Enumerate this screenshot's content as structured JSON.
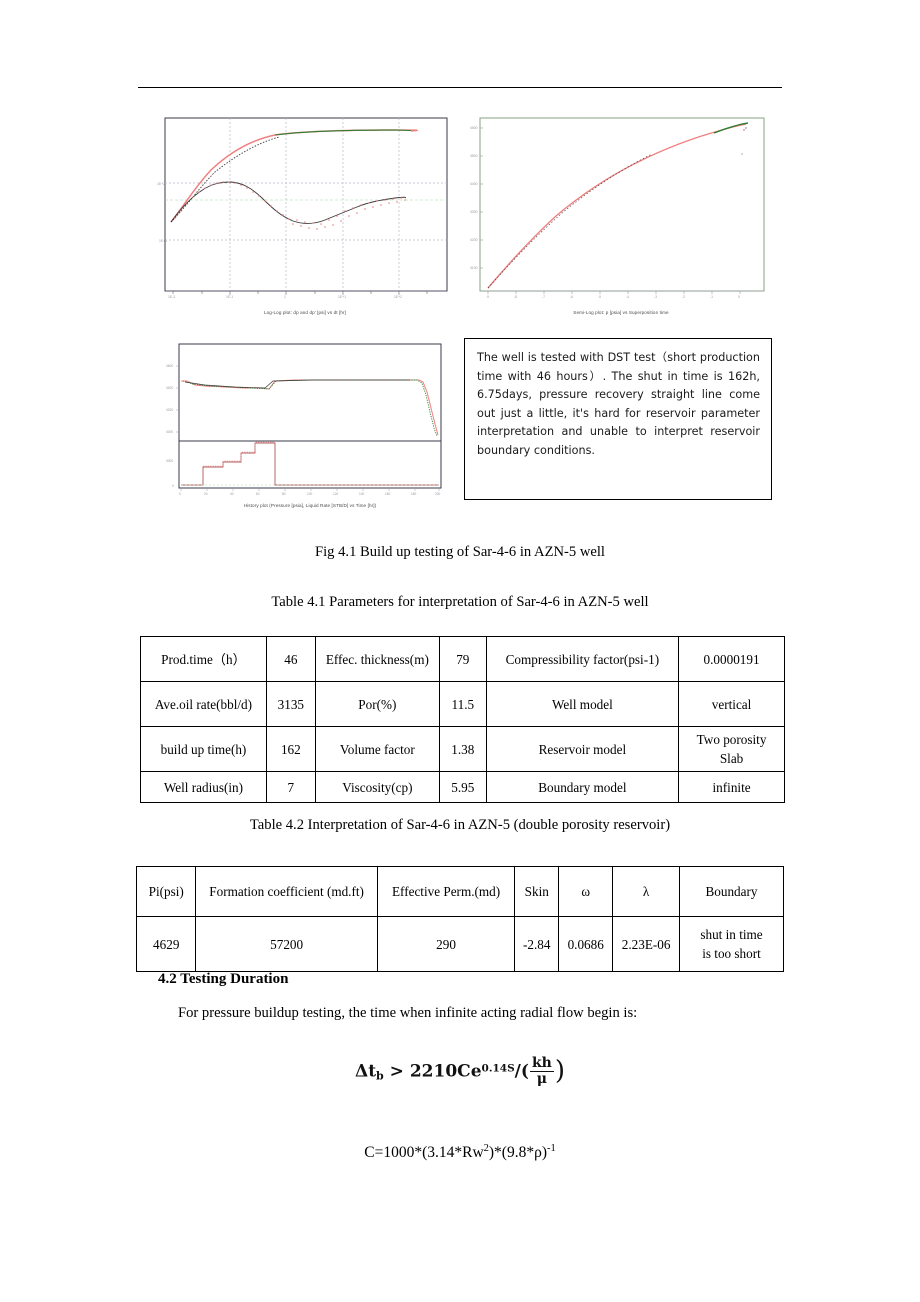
{
  "document": {
    "figure": {
      "title": "Fig 4.1 Build up testing of Sar-4-6 in AZN-5 well",
      "charts": [
        {
          "id": "loglog",
          "caption": "Log-Log plot: dp and dp' [psi] vs dt [hr]",
          "x_ticks": [
            "1E-3",
            "1E-1",
            "1",
            "1E+1",
            "1E+2"
          ],
          "y_ticks": [
            "1E+2",
            "1E+1"
          ]
        },
        {
          "id": "semilog",
          "caption": "Semi-Log plot: p [psia] vs Superposition time",
          "x_ticks": [
            "-9",
            "-8",
            "-7",
            "-6",
            "-5",
            "-4",
            "-3",
            "-2",
            "-1",
            "0"
          ],
          "y_ticks": [
            "4600",
            "4500",
            "4400",
            "4300",
            "4200",
            "4100"
          ]
        },
        {
          "id": "history",
          "caption": "History plot (Pressure [psia], Liquid Rate [STB/D] vs Time [hr])",
          "x_ticks": [
            "0",
            "20",
            "40",
            "60",
            "80",
            "100",
            "120",
            "140",
            "160",
            "180",
            "200"
          ],
          "y_ticks_top": [
            "4600",
            "4400",
            "4200",
            "4000"
          ],
          "y_ticks_bottom": [
            "3000",
            "0"
          ]
        }
      ]
    },
    "notebox": {
      "text": "The well is tested with DST test（short production time with 46 hours）. The shut in time is 162h, 6.75days, pressure recovery straight line come out just a little, it's hard for reservoir parameter interpretation and unable to interpret reservoir boundary conditions."
    },
    "table41": {
      "title": "Table 4.1 Parameters for interpretation of Sar-4-6 in AZN-5 well",
      "rows": [
        [
          "Prod.time（h）",
          "46",
          "Effec. thickness(m)",
          "79",
          "Compressibility factor(psi-1)",
          "0.0000191"
        ],
        [
          "Ave.oil rate(bbl/d)",
          "3135",
          "Por(%)",
          "11.5",
          "Well model",
          "vertical"
        ],
        [
          "build up time(h)",
          "162",
          "Volume factor",
          "1.38",
          "Reservoir model",
          "Two porosity\nSlab"
        ],
        [
          "Well radius(in)",
          "7",
          "Viscosity(cp)",
          "5.95",
          "Boundary model",
          "infinite"
        ]
      ]
    },
    "table42": {
      "title": "Table 4.2 Interpretation of Sar-4-6 in AZN-5 (double porosity reservoir)",
      "headers": [
        "Pi(psi)",
        "Formation coefficient (md.ft)",
        "Effective Perm.(md)",
        "Skin",
        "ω",
        "λ",
        "Boundary"
      ],
      "values": [
        "4629",
        "57200",
        "290",
        "-2.84",
        "0.0686",
        "2.23E-06",
        "shut in time\nis too short"
      ]
    },
    "section": {
      "heading": "4.2 Testing Duration",
      "paragraph": "For pressure buildup testing, the time when infinite acting radial flow begin is:"
    },
    "formulas": {
      "f1_lhs": "Δt",
      "f1_lhs_sub": "b",
      "f1_op": " > ",
      "f1_coeff": "2210Ce",
      "f1_exp": "0.14S",
      "f1_div": "/(",
      "f1_num": "kh",
      "f1_den": "μ",
      "f1_close": ")",
      "f2": "C=1000*(3.14*Rw",
      "f2_sup1": "2",
      "f2_mid": ")*(9.8*ρ)",
      "f2_sup2": "-1"
    }
  },
  "colors": {
    "data_red": "#f08080",
    "model_dark": "#3a3a3a",
    "model_green": "#2f7d32",
    "grid": "#b9b9c8",
    "frame": "#3a3a4a",
    "tick_text": "#9a9aa5"
  }
}
